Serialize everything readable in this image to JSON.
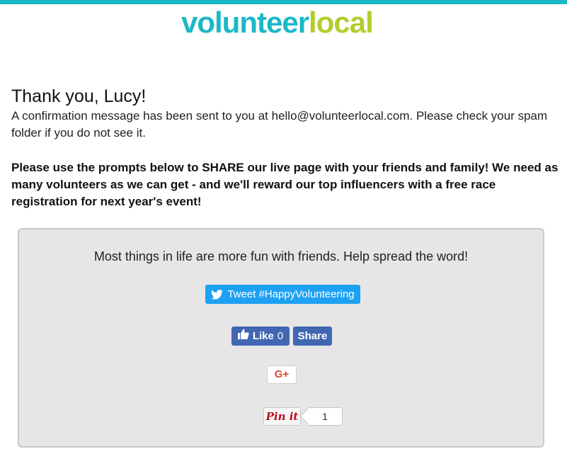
{
  "header": {
    "logo_part1": "volunteer",
    "logo_part2": "local",
    "colors": {
      "accent_teal": "#1bb8c7",
      "accent_green": "#b5cc2c"
    }
  },
  "confirmation": {
    "heading": "Thank you, Lucy!",
    "message": "A confirmation message has been sent to you at hello@volunteerlocal.com. Please check your spam folder if you do not see it.",
    "share_prompt": "Please use the prompts below to SHARE our live page with your friends and family! We need as many volunteers as we can get - and we'll reward our top influencers with a free race registration for next year's event!"
  },
  "share_box": {
    "message": "Most things in life are more fun with friends. Help spread the word!",
    "twitter": {
      "label": "Tweet #HappyVolunteering",
      "icon": "twitter-bird-icon",
      "color": "#1da1f2"
    },
    "facebook": {
      "like_label": "Like",
      "like_count": "0",
      "share_label": "Share",
      "icon": "thumbs-up-icon",
      "color": "#4267b2"
    },
    "google_plus": {
      "label": "G+",
      "color": "#db4437"
    },
    "pinterest": {
      "label": "Pin it",
      "count": "1",
      "color": "#bd081c"
    }
  }
}
